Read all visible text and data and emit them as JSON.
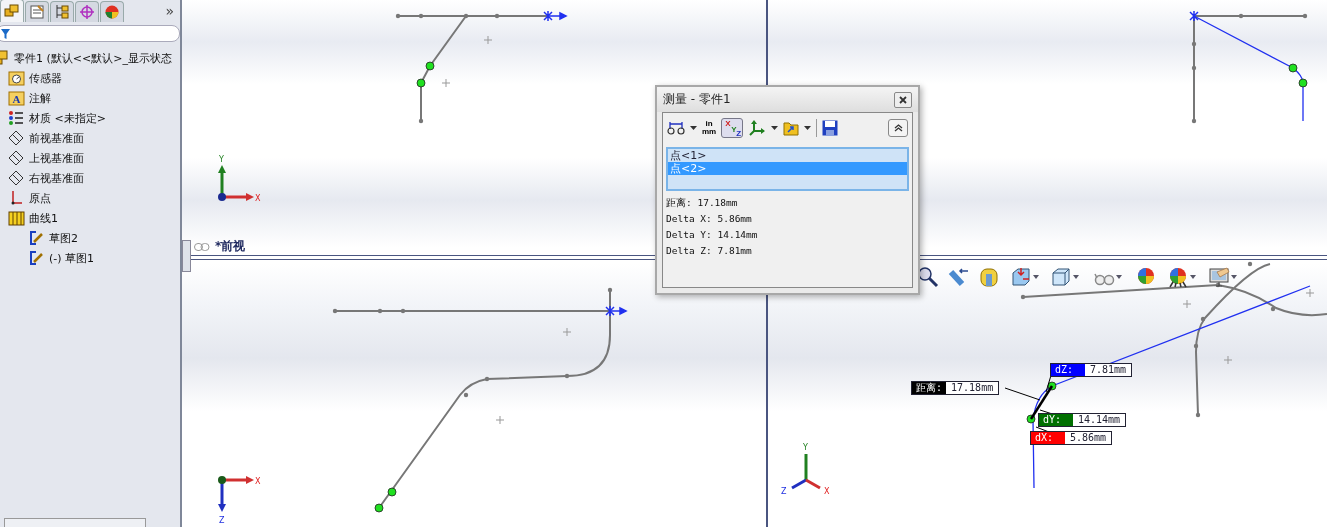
{
  "panel": {
    "tabs": [
      {
        "kind": "feature",
        "selected": true
      },
      {
        "kind": "property",
        "selected": false
      },
      {
        "kind": "config",
        "selected": false
      },
      {
        "kind": "target",
        "selected": false
      },
      {
        "kind": "appearance",
        "selected": false
      }
    ],
    "more": "»",
    "tree": {
      "label": "零件1  (默认<<默认>_显示状态",
      "children": [
        {
          "label": "传感器",
          "kind": "sensor"
        },
        {
          "label": "注解",
          "kind": "annotation",
          "icon_letter": "A"
        },
        {
          "label": "材质 <未指定>",
          "kind": "material"
        },
        {
          "label": "前视基准面",
          "kind": "plane"
        },
        {
          "label": "上视基准面",
          "kind": "plane"
        },
        {
          "label": "右视基准面",
          "kind": "plane"
        },
        {
          "label": "原点",
          "kind": "origin"
        },
        {
          "label": "曲线1",
          "kind": "curve",
          "children": [
            {
              "label": "草图2"
            },
            {
              "label": "(-) 草图1"
            }
          ]
        }
      ]
    }
  },
  "viewport_label": "*前视",
  "triads": [
    {
      "labels": [
        "Y",
        "X"
      ]
    },
    {
      "labels": [
        "X",
        "Z"
      ]
    },
    {
      "labels": [
        "Y",
        "Z",
        "X"
      ]
    }
  ],
  "measure_dialog": {
    "title": "测量 - 零件1",
    "unit_button": [
      "in",
      "mm"
    ],
    "xyz_button": {
      "letters": [
        "X",
        "Y",
        "Z"
      ],
      "on": true
    },
    "selections": [
      {
        "text": "点<1>",
        "selected": false
      },
      {
        "text": "点<2>",
        "selected": true
      }
    ],
    "results": [
      "距离: 17.18mm",
      "Delta X: 5.86mm",
      "Delta Y: 14.14mm",
      "Delta Z: 7.81mm"
    ]
  },
  "dimension_labels": [
    {
      "name": "距离:",
      "value": "17.18mm",
      "color": "#000000"
    },
    {
      "name": "dZ:",
      "value": "7.81mm",
      "color": "#0000ff"
    },
    {
      "name": "dY:",
      "value": "14.14mm",
      "color": "#007000"
    },
    {
      "name": "dX:",
      "value": "5.86mm",
      "color": "#ff0000"
    }
  ]
}
